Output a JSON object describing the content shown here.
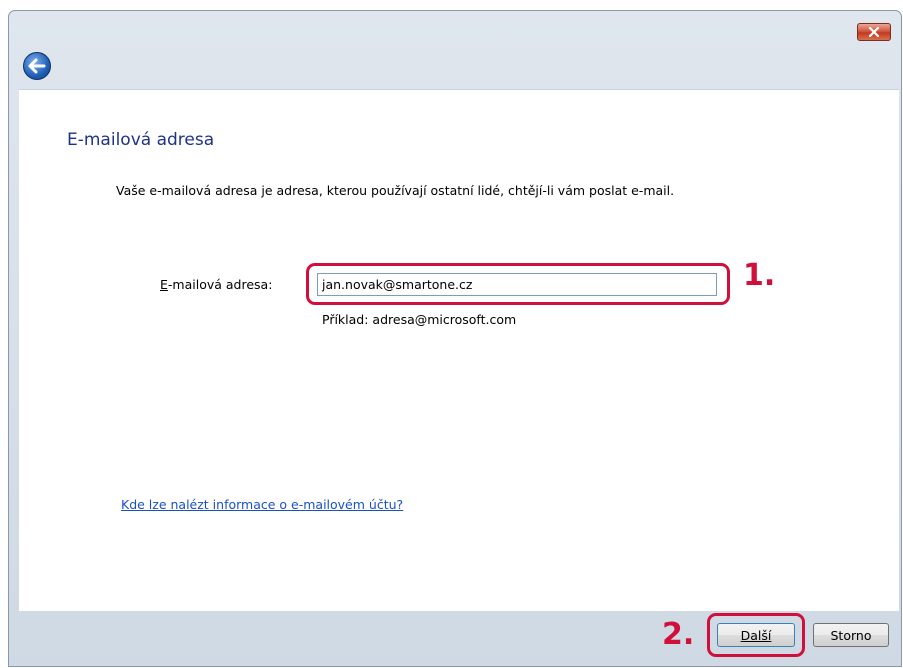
{
  "window": {
    "close_icon": "close-icon",
    "back_icon": "back-arrow-icon"
  },
  "content": {
    "heading": "E-mailová adresa",
    "description": "Vaše e-mailová adresa je adresa, kterou používají ostatní lidé, chtějí-li vám poslat e-mail.",
    "email_label_accesskey": "E",
    "email_label_rest": "-mailová adresa:",
    "email_value": "jan.novak@smartone.cz",
    "example": "Příklad: adresa@microsoft.com",
    "help_link": "Kde lze nalézt informace o e-mailovém účtu?"
  },
  "annotations": {
    "step1": "1.",
    "step2": "2.",
    "color": "#d0103a"
  },
  "footer": {
    "next_label": "Další",
    "cancel_label": "Storno"
  }
}
